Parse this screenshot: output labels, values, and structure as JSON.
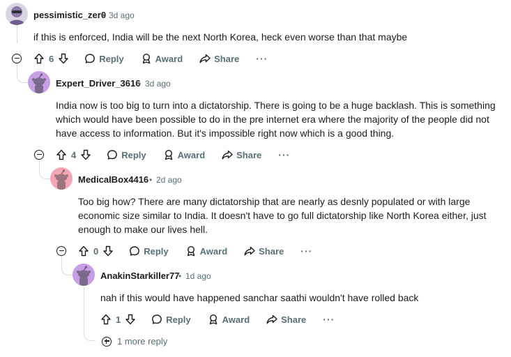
{
  "comments": [
    {
      "username": "pessimistic_zer0",
      "time": "3d ago",
      "body": "if this is enforced, India will be the next North Korea, heck even worse than that maybe",
      "votes": "6",
      "avatar_color": "#8a7aa8"
    },
    {
      "username": "Expert_Driver_3616",
      "time": "3d ago",
      "body": "India now is too big to turn into a dictatorship. There is going to be a huge backlash. This is something which would have been possible to do in the pre internet era where the majority of the people did not have access to information. But it's impossible right now which is a good thing.",
      "votes": "4",
      "avatar_color": "#c89ee6"
    },
    {
      "username": "MedicalBox4416",
      "time": "2d ago",
      "body": "Too big how? There are many dictatorship that are nearly as desnly populated or with large economic size similar to India. It doesn't have to go full dictatorship like North Korea either, just enough to make our lives hell.",
      "votes": "0",
      "avatar_color": "#f4a6b4"
    },
    {
      "username": "AnakinStarkiller77",
      "time": "1d ago",
      "body": "nah if this would have happened sanchar saathi wouldn't have rolled back",
      "votes": "1",
      "avatar_color": "#c89ee6"
    }
  ],
  "actions": {
    "reply": "Reply",
    "award": "Award",
    "share": "Share",
    "more": "···",
    "separator": "•"
  },
  "more_replies": "1 more reply",
  "icons": [
    "upvote-icon",
    "downvote-icon",
    "reply-icon",
    "award-icon",
    "share-icon",
    "collapse-icon",
    "expand-icon",
    "snoo-avatar-icon"
  ]
}
